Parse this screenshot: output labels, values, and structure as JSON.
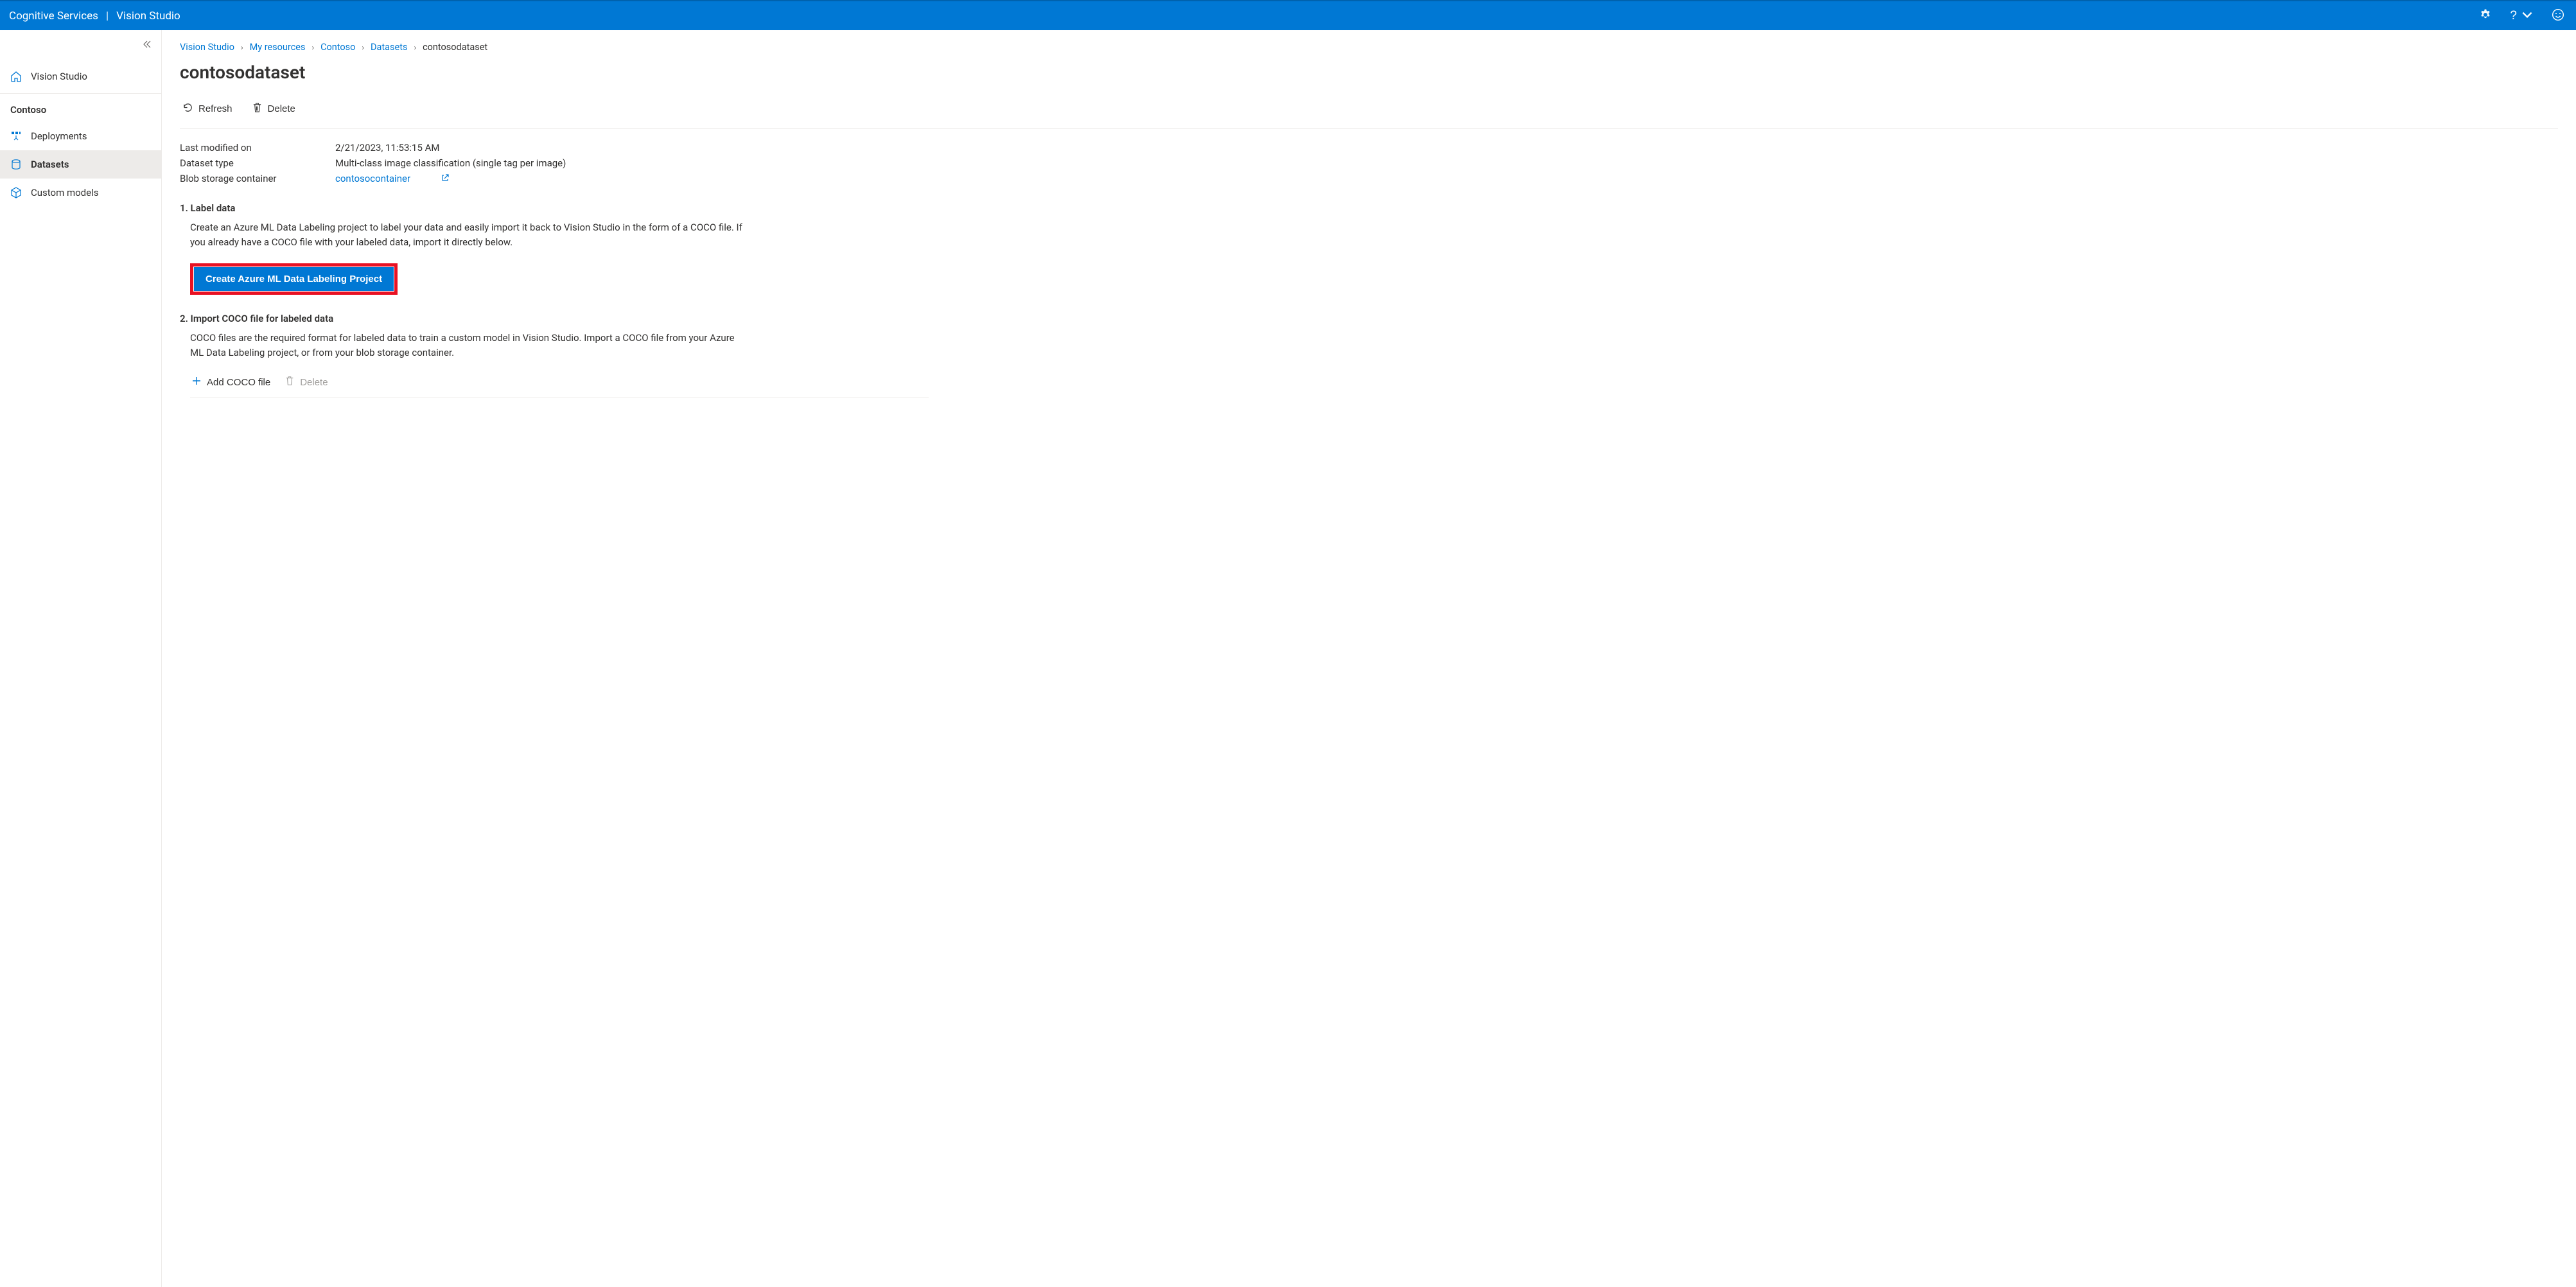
{
  "header": {
    "service": "Cognitive Services",
    "product": "Vision Studio"
  },
  "sidebar": {
    "home_label": "Vision Studio",
    "resource_heading": "Contoso",
    "items": [
      {
        "label": "Deployments"
      },
      {
        "label": "Datasets"
      },
      {
        "label": "Custom models"
      }
    ]
  },
  "breadcrumb": {
    "items": [
      {
        "label": "Vision Studio"
      },
      {
        "label": "My resources"
      },
      {
        "label": "Contoso"
      },
      {
        "label": "Datasets"
      }
    ],
    "current": "contosodataset"
  },
  "page": {
    "title": "contosodataset",
    "toolbar": {
      "refresh": "Refresh",
      "delete": "Delete"
    },
    "meta": {
      "last_modified_label": "Last modified on",
      "last_modified_value": "2/21/2023, 11:53:15 AM",
      "dataset_type_label": "Dataset type",
      "dataset_type_value": "Multi-class image classification (single tag per image)",
      "blob_label": "Blob storage container",
      "blob_link": "contosocontainer"
    },
    "section1": {
      "title": "1. Label data",
      "body": "Create an Azure ML Data Labeling project to label your data and easily import it back to Vision Studio in the form of a COCO file. If you already have a COCO file with your labeled data, import it directly below.",
      "button": "Create Azure ML Data Labeling Project"
    },
    "section2": {
      "title": "2. Import COCO file for labeled data",
      "body": "COCO files are the required format for labeled data to train a custom model in Vision Studio. Import a COCO file from your Azure ML Data Labeling project, or from your blob storage container.",
      "add": "Add COCO file",
      "delete": "Delete"
    }
  }
}
